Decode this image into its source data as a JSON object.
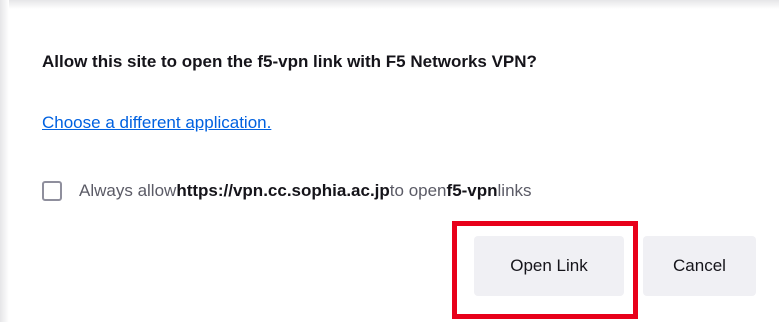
{
  "dialog": {
    "title": "Allow this site to open the f5-vpn link with F5 Networks VPN?",
    "choose_link": "Choose a different application.",
    "checkbox": {
      "checked": false,
      "text_prefix": "Always allow ",
      "site": "https://vpn.cc.sophia.ac.jp",
      "text_middle": " to open ",
      "protocol": "f5-vpn",
      "text_suffix": " links"
    },
    "buttons": {
      "open_label": "Open Link",
      "cancel_label": "Cancel"
    }
  },
  "annotation": {
    "highlight_color": "#e8001a",
    "highlight_target": "open-link-button"
  },
  "colors": {
    "link": "#0061e0",
    "button_bg": "#f0f0f4",
    "text": "#15141a",
    "muted_text": "#5b5b66"
  }
}
